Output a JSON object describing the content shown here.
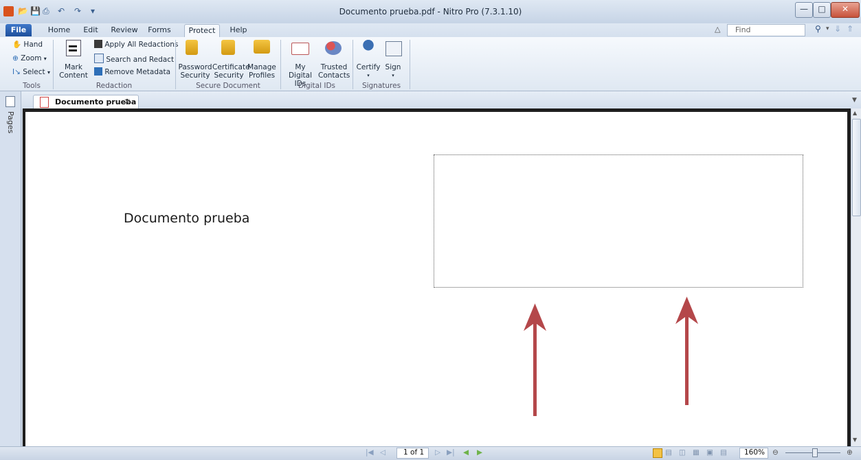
{
  "window": {
    "title": "Documento prueba.pdf - Nitro Pro (7.3.1.10)",
    "controls": [
      "minimize",
      "maximize",
      "close"
    ]
  },
  "menu_tabs": [
    "File",
    "Home",
    "Edit",
    "Review",
    "Forms",
    "Protect",
    "Help"
  ],
  "find": {
    "placeholder": "Find"
  },
  "ribbon": {
    "tools": {
      "label": "Tools",
      "items": [
        "Hand",
        "Zoom",
        "Select"
      ]
    },
    "redaction": {
      "label": "Redaction",
      "mark_content": [
        "Mark",
        "Content"
      ],
      "apply_all": "Apply All Redactions",
      "search_redact": "Search and Redact",
      "remove_metadata": "Remove Metadata"
    },
    "secure_document": {
      "label": "Secure Document",
      "password": [
        "Password",
        "Security"
      ],
      "certificate": [
        "Certificate",
        "Security"
      ],
      "manage": [
        "Manage",
        "Profiles"
      ]
    },
    "digital_ids": {
      "label": "Digital IDs",
      "my_ids": [
        "My Digital",
        "IDs"
      ],
      "trusted": [
        "Trusted",
        "Contacts"
      ]
    },
    "signatures": {
      "label": "Signatures",
      "certify": "Certify",
      "sign": "Sign"
    }
  },
  "side_panel": {
    "pages_label": "Pages"
  },
  "document_tab": {
    "title": "Documento prueba"
  },
  "document": {
    "body_text": "Documento prueba"
  },
  "status_bar": {
    "page_indicator": "1 of 1",
    "zoom": "160%"
  }
}
